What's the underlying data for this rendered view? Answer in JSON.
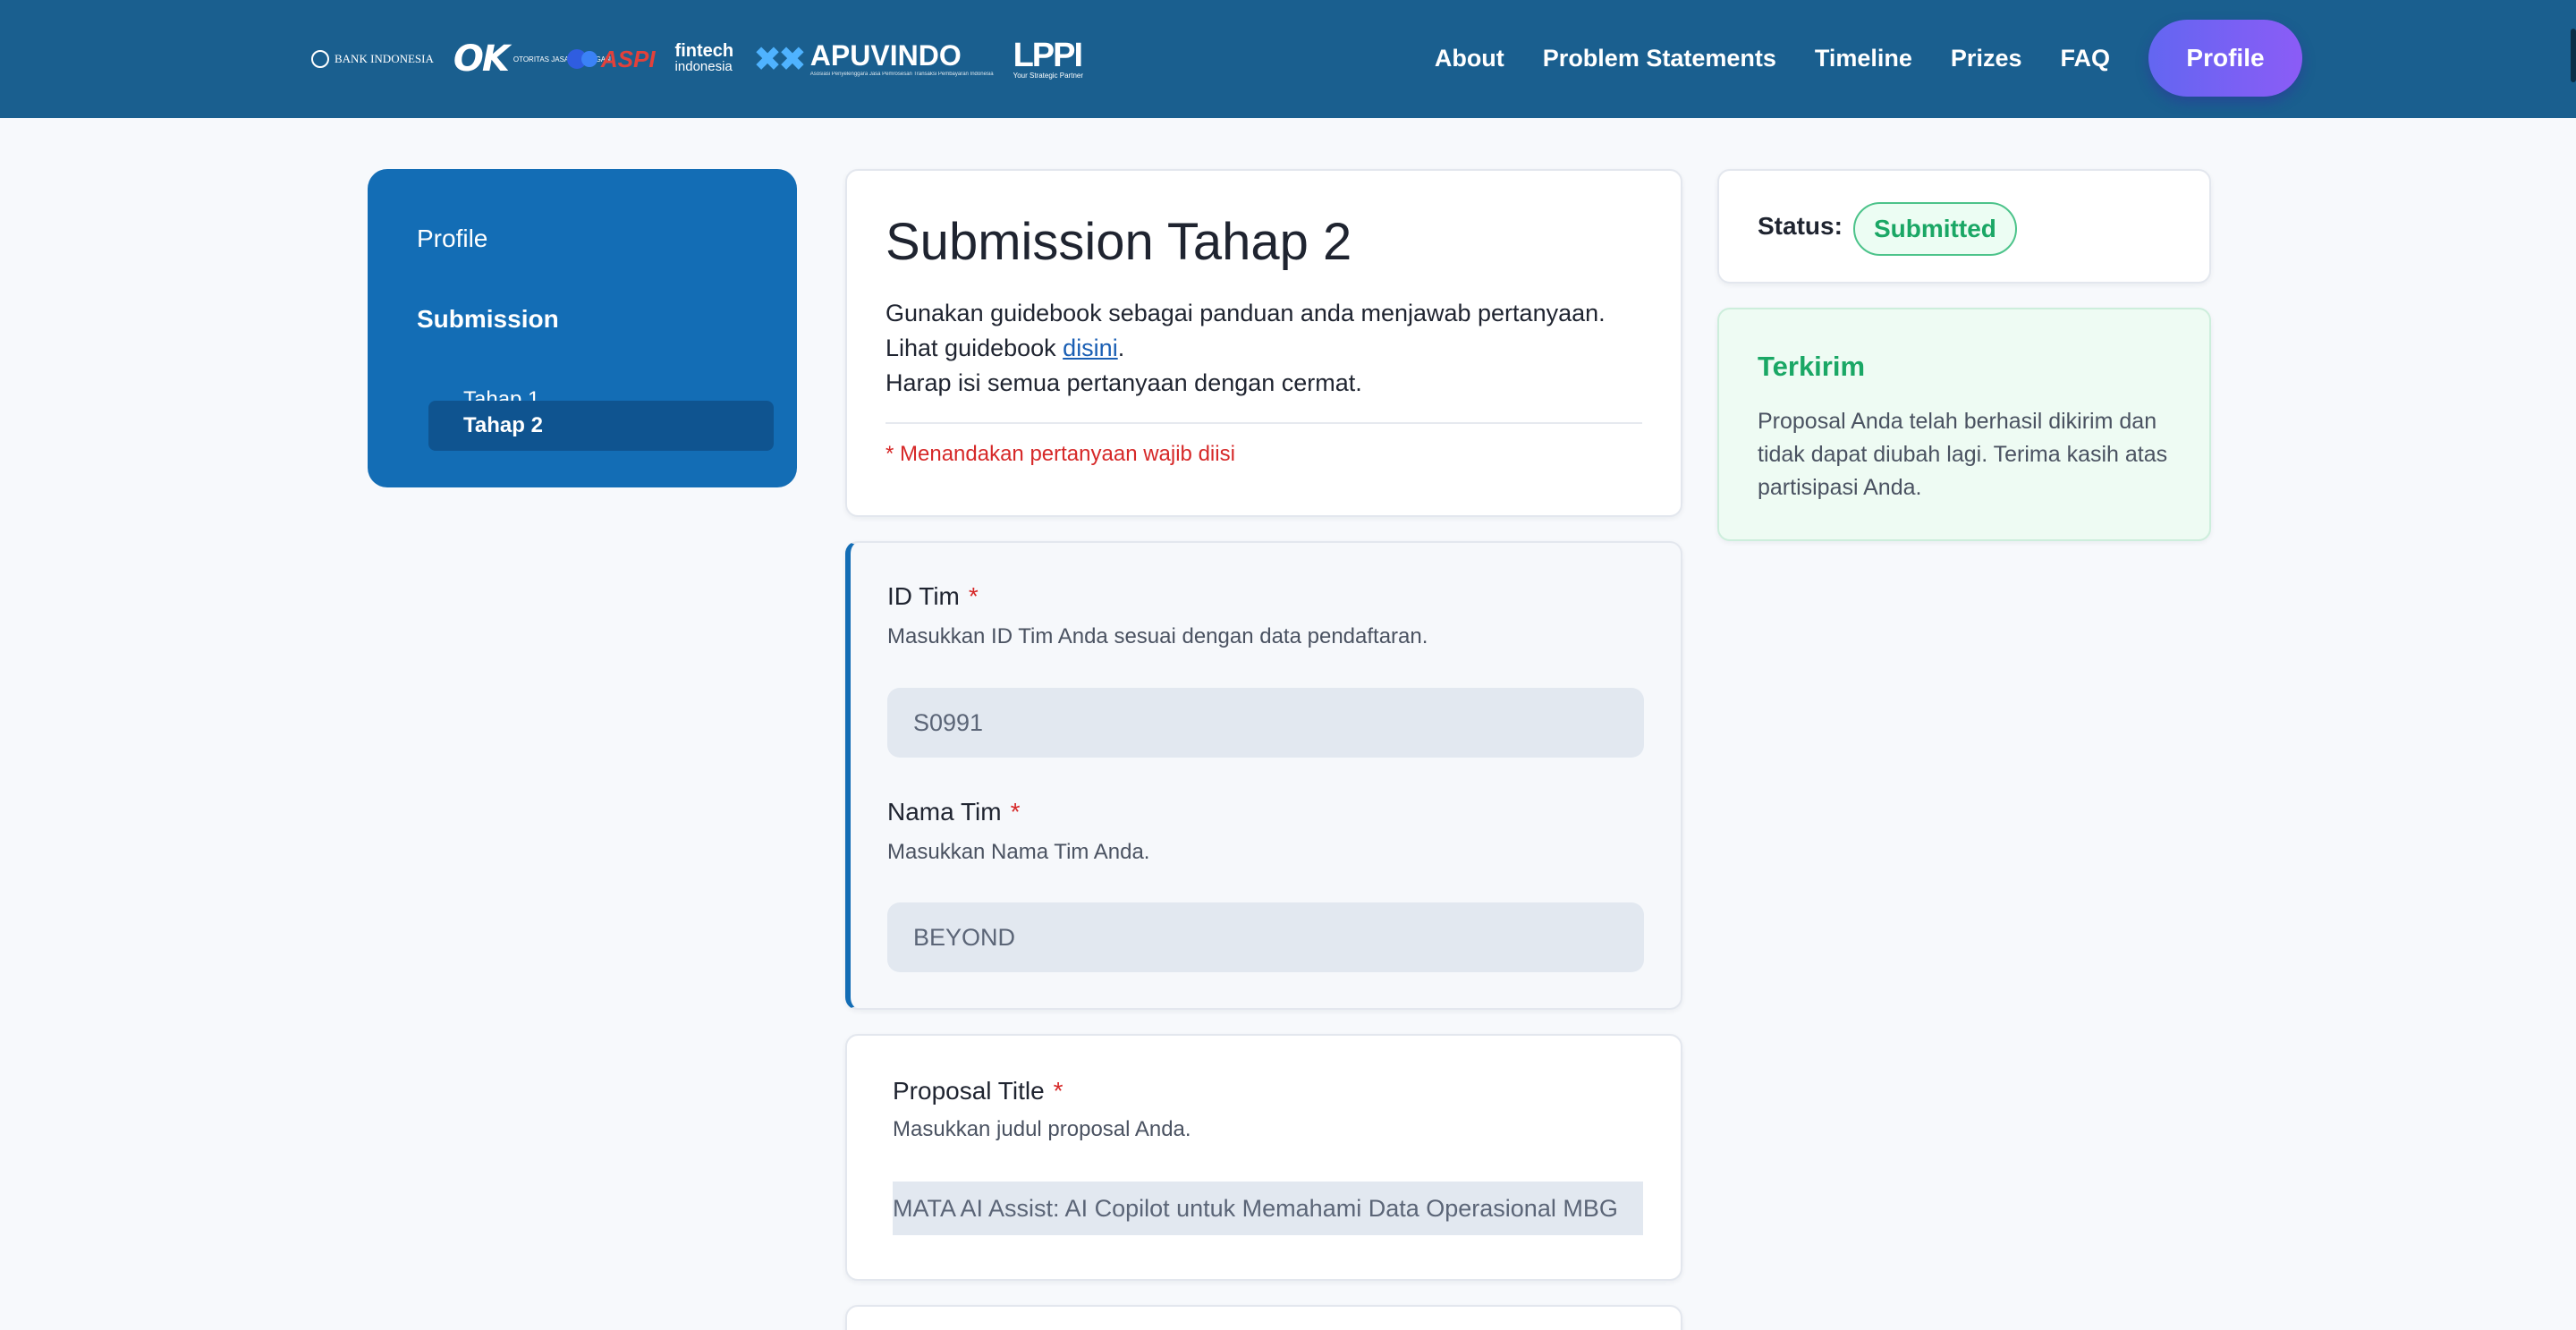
{
  "header": {
    "logos": {
      "bank_indonesia": "BANK INDONESIA",
      "ojk_big": "OK",
      "ojk_small": "OTORITAS JASA KEUANGAN",
      "aspi": "ASPI",
      "fintech_a": "fintech",
      "fintech_b": "indonesia",
      "apuvindo": "APUVINDO",
      "apuvindo_sub": "Asosiasi Penyelenggara Jasa Pemrosesan Transaksi Pembayaran Indonesia",
      "lppi": "LPPI",
      "lppi_sub": "Your Strategic Partner"
    },
    "nav": [
      "About",
      "Problem Statements",
      "Timeline",
      "Prizes",
      "FAQ"
    ],
    "profile_button": "Profile"
  },
  "sidebar": {
    "profile": "Profile",
    "submission": "Submission",
    "items": [
      "Tahap 1",
      "Tahap 2"
    ],
    "active": "Tahap 2"
  },
  "intro": {
    "title": "Submission Tahap 2",
    "line1": "Gunakan guidebook sebagai panduan anda menjawab pertanyaan.",
    "line2_prefix": "Lihat guidebook ",
    "line2_link": "disini",
    "line2_suffix": ".",
    "line3": "Harap isi semua pertanyaan dengan cermat.",
    "required_note": "* Menandakan pertanyaan wajib diisi"
  },
  "fields": {
    "team_id": {
      "label": "ID Tim",
      "required": "*",
      "help": "Masukkan ID Tim Anda sesuai dengan data pendaftaran.",
      "value": "S0991"
    },
    "team_name": {
      "label": "Nama Tim",
      "required": "*",
      "help": "Masukkan Nama Tim Anda.",
      "value": "BEYOND"
    },
    "proposal_title": {
      "label": "Proposal Title",
      "required": "*",
      "help": "Masukkan judul proposal Anda.",
      "value": "MATA AI Assist: AI Copilot untuk Memahami Data Operasional MBG"
    }
  },
  "status": {
    "label": "Status:",
    "badge": "Submitted",
    "badge_color": "#1aa765"
  },
  "sent": {
    "title": "Terkirim",
    "body": "Proposal Anda telah berhasil dikirim dan tidak dapat diubah lagi. Terima kasih atas partisipasi Anda."
  },
  "colors": {
    "header_bg": "#1a5f8f",
    "sidebar_bg": "#136db5",
    "accent_gradient_start": "#6366f1",
    "accent_gradient_end": "#8b5cf6",
    "required_red": "#d62828"
  }
}
